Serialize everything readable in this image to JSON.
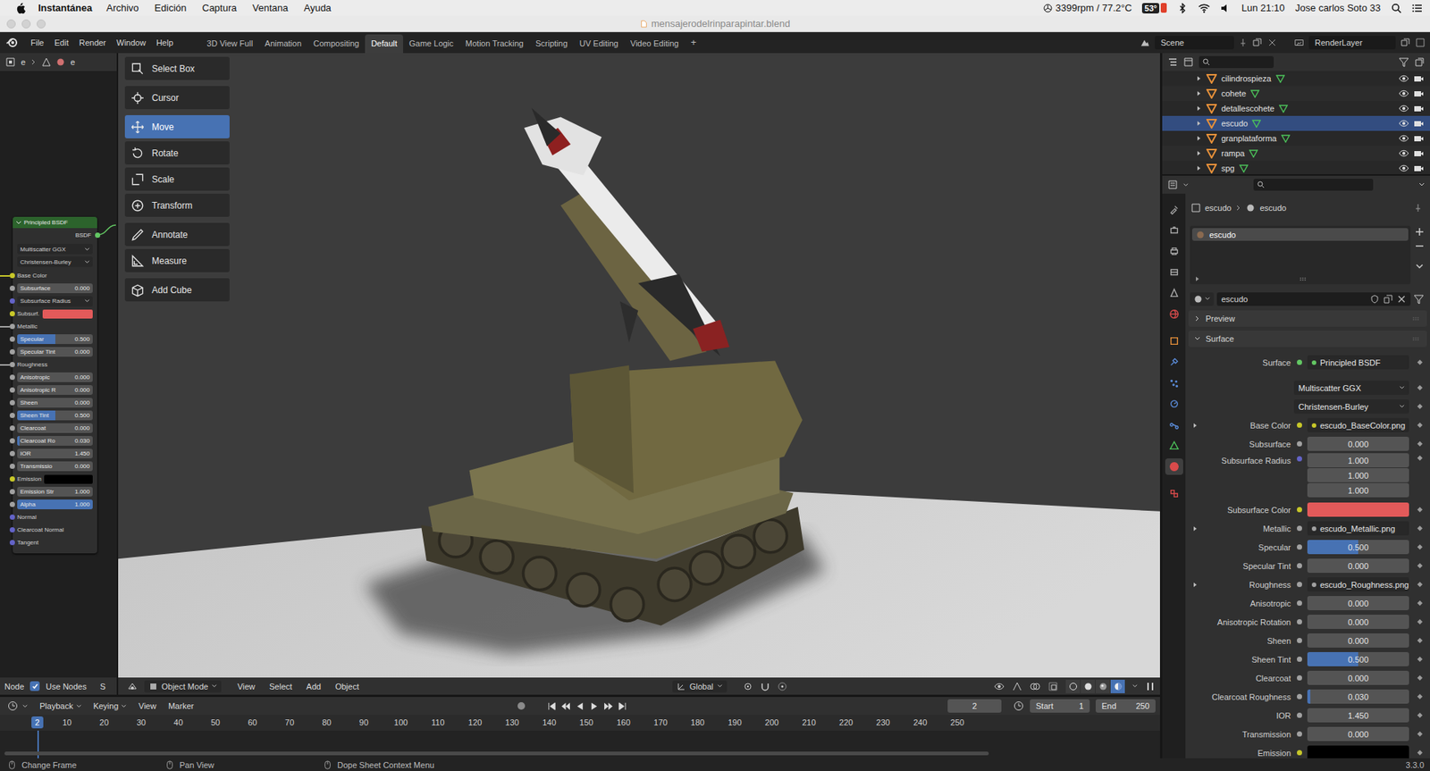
{
  "menubar": {
    "app": "Instantánea",
    "menus": [
      "Archivo",
      "Edición",
      "Captura",
      "Ventana",
      "Ayuda"
    ],
    "fan": "3399rpm / 77.2°C",
    "temperature": "53°",
    "clock": "Lun 21:10",
    "user": "Jose carlos Soto 33"
  },
  "window": {
    "title": "mensajerodelrinparapintar.blend"
  },
  "topbar": {
    "menus": [
      "File",
      "Edit",
      "Render",
      "Window",
      "Help"
    ],
    "workspaces": [
      {
        "label": "3D View Full",
        "selected": false
      },
      {
        "label": "Animation",
        "selected": false
      },
      {
        "label": "Compositing",
        "selected": false
      },
      {
        "label": "Default",
        "selected": true
      },
      {
        "label": "Game Logic",
        "selected": false
      },
      {
        "label": "Motion Tracking",
        "selected": false
      },
      {
        "label": "Scripting",
        "selected": false
      },
      {
        "label": "UV Editing",
        "selected": false
      },
      {
        "label": "Video Editing",
        "selected": false
      }
    ],
    "add_workspace": "+",
    "scene": "Scene",
    "view_layer": "RenderLayer"
  },
  "node_editor": {
    "breadcrumb": [
      "e",
      "e"
    ],
    "node": {
      "title": "Principled BSDF",
      "output": "BSDF",
      "dropdowns": [
        "Multiscatter GGX",
        "Christensen-Burley"
      ],
      "inputs": [
        {
          "kind": "label",
          "label": "Base Color",
          "socket": "#c7c729",
          "linked": true
        },
        {
          "kind": "field",
          "label": "Subsurface",
          "value": "0.000",
          "level": 0,
          "socket": "#a1a1a1",
          "linked": false
        },
        {
          "kind": "dropdown",
          "label": "Subsurface Radius",
          "socket": "#6363c7",
          "linked": false
        },
        {
          "kind": "swatch",
          "label": "Subsurf.",
          "swatch": "#e35a5a",
          "socket": "#c7c729",
          "linked": false
        },
        {
          "kind": "label",
          "label": "Metallic",
          "socket": "#a1a1a1",
          "linked": true
        },
        {
          "kind": "field",
          "label": "Specular",
          "value": "0.500",
          "level": 0.5,
          "socket": "#a1a1a1",
          "linked": false
        },
        {
          "kind": "field",
          "label": "Specular Tint",
          "value": "0.000",
          "level": 0,
          "socket": "#a1a1a1",
          "linked": false
        },
        {
          "kind": "label",
          "label": "Roughness",
          "socket": "#a1a1a1",
          "linked": true
        },
        {
          "kind": "field",
          "label": "Anisotropic",
          "value": "0.000",
          "level": 0,
          "socket": "#a1a1a1",
          "linked": false
        },
        {
          "kind": "field",
          "label": "Anisotropic R",
          "value": "0.000",
          "level": 0,
          "socket": "#a1a1a1",
          "linked": false
        },
        {
          "kind": "field",
          "label": "Sheen",
          "value": "0.000",
          "level": 0,
          "socket": "#a1a1a1",
          "linked": false
        },
        {
          "kind": "field",
          "label": "Sheen Tint",
          "value": "0.500",
          "level": 0.5,
          "socket": "#a1a1a1",
          "linked": false
        },
        {
          "kind": "field",
          "label": "Clearcoat",
          "value": "0.000",
          "level": 0,
          "socket": "#a1a1a1",
          "linked": false
        },
        {
          "kind": "field",
          "label": "Clearcoat Ro",
          "value": "0.030",
          "level": 0.03,
          "socket": "#a1a1a1",
          "linked": false
        },
        {
          "kind": "field",
          "label": "IOR",
          "value": "1.450",
          "level": 0,
          "socket": "#a1a1a1",
          "linked": false
        },
        {
          "kind": "field",
          "label": "Transmissio",
          "value": "0.000",
          "level": 0,
          "socket": "#a1a1a1",
          "linked": false
        },
        {
          "kind": "swatch",
          "label": "Emission",
          "swatch": "#000000",
          "socket": "#c7c729",
          "linked": false
        },
        {
          "kind": "field",
          "label": "Emission Str",
          "value": "1.000",
          "level": 0,
          "socket": "#a1a1a1",
          "linked": false
        },
        {
          "kind": "field",
          "label": "Alpha",
          "value": "1.000",
          "level": 1,
          "socket": "#a1a1a1",
          "linked": false
        },
        {
          "kind": "label",
          "label": "Normal",
          "socket": "#6363c7",
          "linked": false
        },
        {
          "kind": "label",
          "label": "Clearcoat Normal",
          "socket": "#6363c7",
          "linked": false
        },
        {
          "kind": "label",
          "label": "Tangent",
          "socket": "#6363c7",
          "linked": false
        }
      ]
    },
    "footer": {
      "menu": "Node",
      "use_nodes": {
        "label": "Use Nodes",
        "checked": true
      },
      "cut_label": "S"
    }
  },
  "toolbar": {
    "groups": [
      [
        {
          "label": "Select Box",
          "selected": false
        }
      ],
      [
        {
          "label": "Cursor",
          "selected": false
        }
      ],
      [
        {
          "label": "Move",
          "selected": true
        },
        {
          "label": "Rotate",
          "selected": false
        },
        {
          "label": "Scale",
          "selected": false
        },
        {
          "label": "Transform",
          "selected": false
        }
      ],
      [
        {
          "label": "Annotate",
          "selected": false
        },
        {
          "label": "Measure",
          "selected": false
        }
      ],
      [
        {
          "label": "Add Cube",
          "selected": false
        }
      ]
    ]
  },
  "viewport_header": {
    "mode": "Object Mode",
    "menus": [
      "View",
      "Select",
      "Add",
      "Object"
    ],
    "orientation": "Global",
    "shading": [
      {
        "selected": false
      },
      {
        "selected": false
      },
      {
        "selected": false
      },
      {
        "selected": true
      }
    ]
  },
  "timeline": {
    "menus": [
      {
        "label": "Playback",
        "dropdown": true
      },
      {
        "label": "Keying",
        "dropdown": true
      },
      {
        "label": "View",
        "dropdown": false
      },
      {
        "label": "Marker",
        "dropdown": false
      }
    ],
    "auto_key": false,
    "current_frame": "2",
    "start": {
      "label": "Start",
      "value": "1"
    },
    "end": {
      "label": "End",
      "value": "250"
    },
    "ruler": [
      "10",
      "20",
      "30",
      "40",
      "50",
      "60",
      "70",
      "80",
      "90",
      "100",
      "110",
      "120",
      "130",
      "140",
      "150",
      "160",
      "170",
      "180",
      "190",
      "200",
      "210",
      "220",
      "230",
      "240",
      "250"
    ],
    "playhead": "2"
  },
  "outliner": {
    "items": [
      {
        "name": "cilindrospieza",
        "selected": false
      },
      {
        "name": "cohete",
        "selected": false
      },
      {
        "name": "detallescohete",
        "selected": false
      },
      {
        "name": "escudo",
        "selected": true
      },
      {
        "name": "granplataforma",
        "selected": false
      },
      {
        "name": "rampa",
        "selected": false
      },
      {
        "name": "spg",
        "selected": false
      }
    ]
  },
  "properties": {
    "tabs": [
      {
        "color": "#a8a8a8",
        "selected": false
      },
      {
        "color": "#a8a8a8",
        "selected": false
      },
      {
        "color": "#a8a8a8",
        "selected": false
      },
      {
        "color": "#a8a8a8",
        "selected": false
      },
      {
        "color": "#a8a8a8",
        "selected": false
      },
      {
        "color": "#d04a4a",
        "selected": false
      },
      {
        "color": "#e8913a",
        "selected": false
      },
      {
        "color": "#5b8ddb",
        "selected": false
      },
      {
        "color": "#5b8ddb",
        "selected": false
      },
      {
        "color": "#5b8ddb",
        "selected": false
      },
      {
        "color": "#5b8ddb",
        "selected": false
      },
      {
        "color": "#4cc25a",
        "selected": false
      },
      {
        "color": "#d94b4b",
        "selected": true
      },
      {
        "color": "#d94b4b",
        "selected": false
      }
    ],
    "breadcrumb": [
      "escudo",
      "escudo"
    ],
    "slots": [
      {
        "name": "escudo",
        "selected": true
      }
    ],
    "material": "escudo",
    "panels": [
      {
        "label": "Preview",
        "expanded": false
      },
      {
        "label": "Surface",
        "expanded": true
      }
    ],
    "rows": [
      {
        "kind": "shader",
        "label": "Surface",
        "value": "Principled BSDF",
        "socket": "#63c763"
      },
      {
        "kind": "dropdown",
        "value": "Multiscatter GGX"
      },
      {
        "kind": "dropdown",
        "value": "Christensen-Burley"
      },
      {
        "kind": "link",
        "label": "Base Color",
        "value": "escudo_BaseColor.png",
        "socket": "#c7c729",
        "expanded": false
      },
      {
        "kind": "number",
        "label": "Subsurface",
        "value": "0.000",
        "level": 0,
        "socket": "#a1a1a1"
      },
      {
        "kind": "vector",
        "label": "Subsurface Radius",
        "values": [
          "1.000",
          "1.000",
          "1.000"
        ],
        "socket": "#6363c7"
      },
      {
        "kind": "color",
        "label": "Subsurface Color",
        "swatch": "#e35a5a",
        "socket": "#c7c729"
      },
      {
        "kind": "link",
        "label": "Metallic",
        "value": "escudo_Metallic.png",
        "socket": "#a1a1a1",
        "expanded": false
      },
      {
        "kind": "number",
        "label": "Specular",
        "value": "0.500",
        "level": 0.5,
        "socket": "#a1a1a1"
      },
      {
        "kind": "number",
        "label": "Specular Tint",
        "value": "0.000",
        "level": 0,
        "socket": "#a1a1a1"
      },
      {
        "kind": "link",
        "label": "Roughness",
        "value": "escudo_Roughness.png",
        "socket": "#a1a1a1",
        "expanded": false
      },
      {
        "kind": "number",
        "label": "Anisotropic",
        "value": "0.000",
        "level": 0,
        "socket": "#a1a1a1"
      },
      {
        "kind": "number",
        "label": "Anisotropic Rotation",
        "value": "0.000",
        "level": 0,
        "socket": "#a1a1a1"
      },
      {
        "kind": "number",
        "label": "Sheen",
        "value": "0.000",
        "level": 0,
        "socket": "#a1a1a1"
      },
      {
        "kind": "number",
        "label": "Sheen Tint",
        "value": "0.500",
        "level": 0.5,
        "socket": "#a1a1a1"
      },
      {
        "kind": "number",
        "label": "Clearcoat",
        "value": "0.000",
        "level": 0,
        "socket": "#a1a1a1"
      },
      {
        "kind": "number",
        "label": "Clearcoat Roughness",
        "value": "0.030",
        "level": 0.03,
        "socket": "#a1a1a1"
      },
      {
        "kind": "number",
        "label": "IOR",
        "value": "1.450",
        "level": 0,
        "socket": "#a1a1a1"
      },
      {
        "kind": "number",
        "label": "Transmission",
        "value": "0.000",
        "level": 0,
        "socket": "#a1a1a1"
      },
      {
        "kind": "color",
        "label": "Emission",
        "swatch": "#000000",
        "socket": "#c7c729"
      }
    ]
  },
  "status_bar": {
    "items": [
      "Change Frame",
      "Pan View",
      "Dope Sheet Context Menu"
    ],
    "version": "3.3.0"
  }
}
